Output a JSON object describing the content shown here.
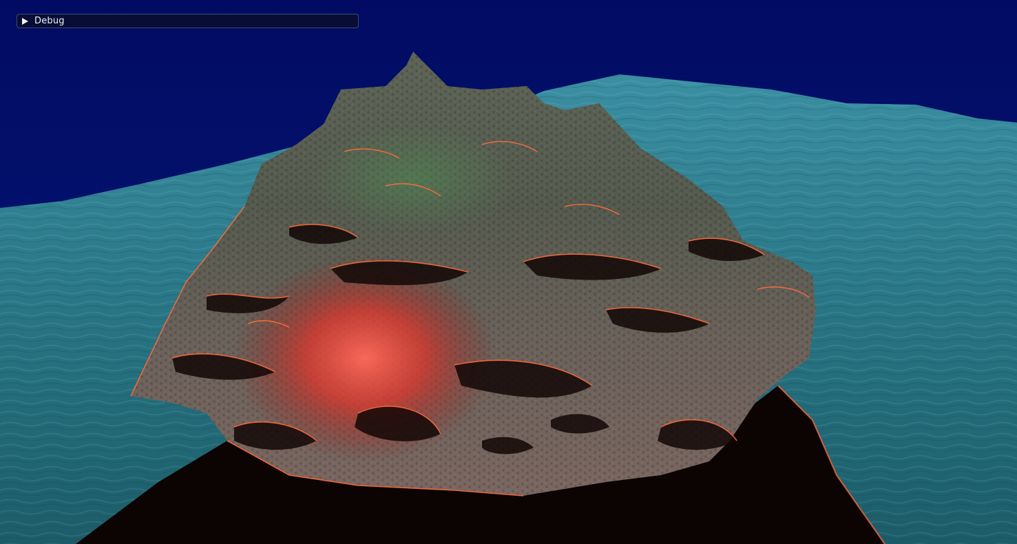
{
  "scene": {
    "sky_color": "#020c66",
    "water_color": "#1f6f7e",
    "terrain_color": "#6f6a5c",
    "lava_glow_color": "#ff4a3a",
    "edge_highlight_color": "#ff6a3a"
  },
  "debug_panel": {
    "label": "Debug",
    "collapsed": true,
    "icon": "triangle-right-icon"
  }
}
